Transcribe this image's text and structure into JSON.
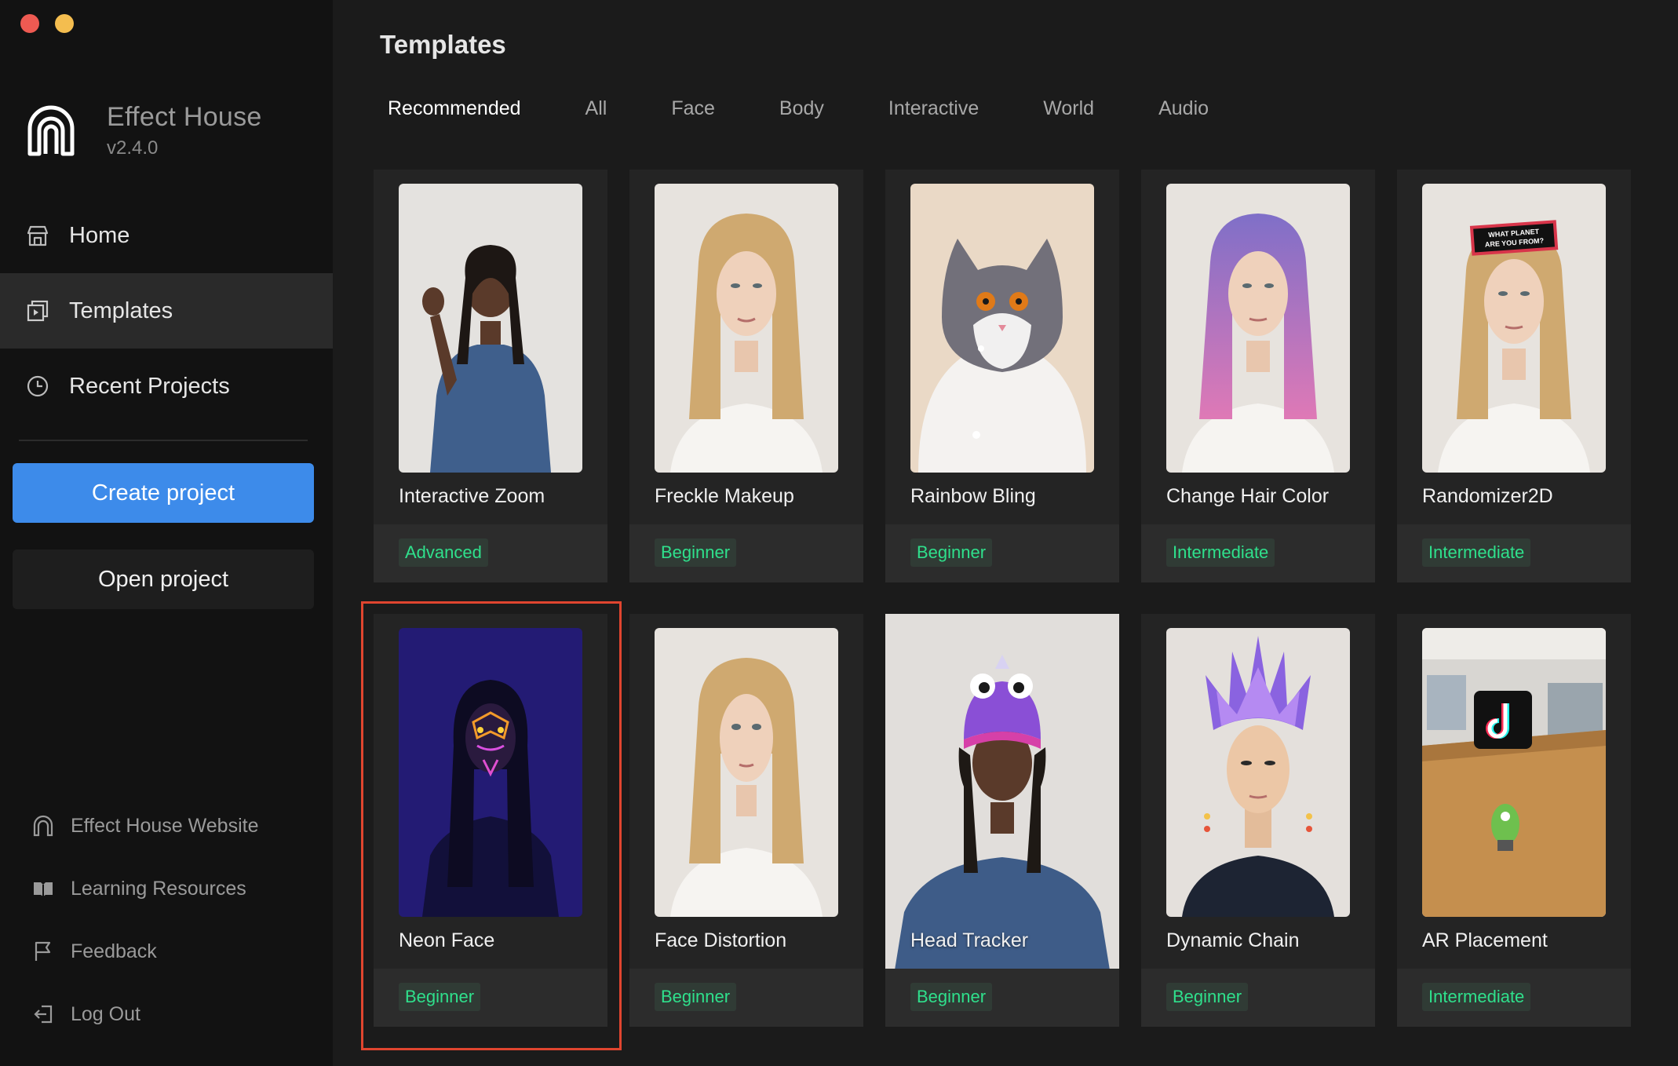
{
  "window": {
    "controls": [
      "close",
      "minimize"
    ]
  },
  "brand": {
    "name": "Effect House",
    "version": "v2.4.0",
    "logo_icon": "arch-icon"
  },
  "sidebar": {
    "nav": [
      {
        "label": "Home",
        "icon": "home-icon"
      },
      {
        "label": "Templates",
        "icon": "templates-icon",
        "active": true
      },
      {
        "label": "Recent Projects",
        "icon": "clock-icon"
      }
    ],
    "create_label": "Create project",
    "open_label": "Open project",
    "links": [
      {
        "label": "Effect House Website",
        "icon": "arch-icon"
      },
      {
        "label": "Learning Resources",
        "icon": "book-icon"
      },
      {
        "label": "Feedback",
        "icon": "flag-icon"
      },
      {
        "label": "Log Out",
        "icon": "logout-icon"
      }
    ]
  },
  "main": {
    "title": "Templates",
    "tabs": [
      "Recommended",
      "All",
      "Face",
      "Body",
      "Interactive",
      "World",
      "Audio"
    ],
    "active_tab": "Recommended",
    "templates": [
      {
        "title": "Interactive Zoom",
        "level": "Advanced"
      },
      {
        "title": "Freckle Makeup",
        "level": "Beginner"
      },
      {
        "title": "Rainbow Bling",
        "level": "Beginner"
      },
      {
        "title": "Change Hair Color",
        "level": "Intermediate"
      },
      {
        "title": "Randomizer2D",
        "level": "Intermediate",
        "sign_text_1": "WHAT PLANET",
        "sign_text_2": "ARE YOU FROM?"
      },
      {
        "title": "Neon Face",
        "level": "Beginner",
        "selected": true
      },
      {
        "title": "Face Distortion",
        "level": "Beginner"
      },
      {
        "title": "Head Tracker",
        "level": "Beginner"
      },
      {
        "title": "Dynamic Chain",
        "level": "Beginner"
      },
      {
        "title": "AR Placement",
        "level": "Intermediate"
      }
    ]
  },
  "colors": {
    "accent": "#3d8bea",
    "level_text": "#2fe08c",
    "selection": "#e0452f"
  }
}
